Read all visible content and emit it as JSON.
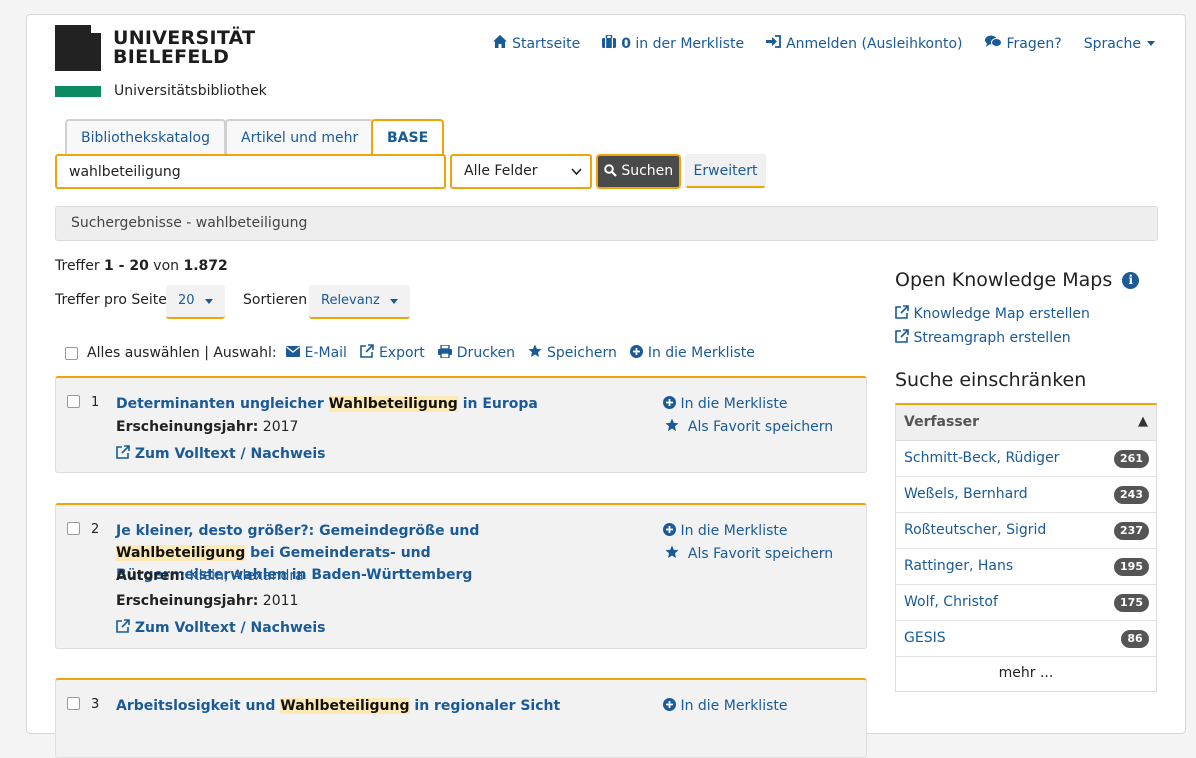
{
  "header": {
    "logo_line1": "UNIVERSITÄT",
    "logo_line2": "BIELEFELD",
    "logo_sub": "Universitätsbibliothek",
    "nav": {
      "home": "Startseite",
      "list_count": "0",
      "list_label": "in der Merkliste",
      "login": "Anmelden (Ausleihkonto)",
      "questions": "Fragen?",
      "language": "Sprache"
    }
  },
  "tabs": [
    "Bibliothekskatalog",
    "Artikel und mehr",
    "BASE"
  ],
  "search": {
    "query": "wahlbeteiligung",
    "field": "Alle Felder",
    "submit": "Suchen",
    "advanced": "Erweitert"
  },
  "breadcrumb": "Suchergebnisse - wahlbeteiligung",
  "results_info": {
    "prefix": "Treffer",
    "range": "1 - 20",
    "of": "von",
    "total": "1.872",
    "per_page_label": "Treffer pro Seite",
    "per_page_value": "20",
    "sort_label": "Sortieren",
    "sort_value": "Relevanz"
  },
  "bulk_actions": {
    "select_all": "Alles auswählen | Auswahl:",
    "email": "E-Mail",
    "export": "Export",
    "print": "Drucken",
    "save": "Speichern",
    "add_list": "In die Merkliste"
  },
  "results": [
    {
      "num": "1",
      "title_pre": "Determinanten ungleicher ",
      "title_hl": "Wahlbeteiligung",
      "title_post": " in Europa",
      "year_label": "Erscheinungsjahr:",
      "year": "2017",
      "fulltext": "Zum Volltext / Nachweis",
      "add_list": "In die Merkliste",
      "favorite": "Als Favorit speichern"
    },
    {
      "num": "2",
      "title_pre": "Je kleiner, desto größer?: Gemeindegröße und ",
      "title_hl": "Wahlbeteiligung",
      "title_post": " bei Gemeinderats- und Bürgermeisterwahlen in Baden-Württemberg",
      "authors_label": "Autoren:",
      "authors": "Klein, Alexandra",
      "year_label": "Erscheinungsjahr:",
      "year": "2011",
      "fulltext": "Zum Volltext / Nachweis",
      "add_list": "In die Merkliste",
      "favorite": "Als Favorit speichern"
    },
    {
      "num": "3",
      "title_pre": "Arbeitslosigkeit und ",
      "title_hl": "Wahlbeteiligung",
      "title_post": " in regionaler Sicht",
      "add_list": "In die Merkliste"
    }
  ],
  "sidebar": {
    "okm_title": "Open Knowledge Maps",
    "okm_map": "Knowledge Map erstellen",
    "okm_stream": "Streamgraph erstellen",
    "narrow_title": "Suche einschränken",
    "facet_title": "Verfasser",
    "facet_items": [
      {
        "name": "Schmitt-Beck, Rüdiger",
        "count": "261"
      },
      {
        "name": "Weßels, Bernhard",
        "count": "243"
      },
      {
        "name": "Roßteutscher, Sigrid",
        "count": "237"
      },
      {
        "name": "Rattinger, Hans",
        "count": "195"
      },
      {
        "name": "Wolf, Christof",
        "count": "175"
      },
      {
        "name": "GESIS",
        "count": "86"
      }
    ],
    "facet_more": "mehr ..."
  },
  "colors": {
    "accent": "#f0a40a",
    "link": "#1a5a96",
    "brand_green": "#0b8a64",
    "highlight": "#fde9b5"
  }
}
